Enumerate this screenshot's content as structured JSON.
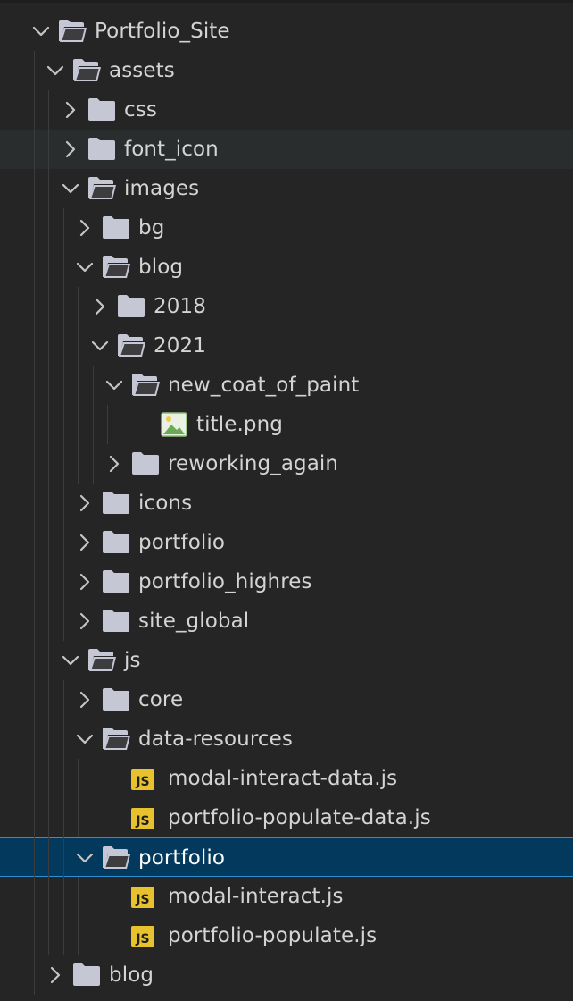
{
  "colors": {
    "background": "#252526",
    "text": "#d4d4d4",
    "selected_bg": "#04395e",
    "selected_border": "#2b8fd6",
    "hover_bg": "#2a2d2e",
    "folder_icon": "#c5c8d4",
    "js_badge": "#e8c12f"
  },
  "tree": [
    {
      "label": "Portfolio_Site",
      "depth": 0,
      "kind": "folder",
      "expanded": true,
      "icon": "folder-open-icon"
    },
    {
      "label": "assets",
      "depth": 1,
      "kind": "folder",
      "expanded": true,
      "icon": "folder-open-icon"
    },
    {
      "label": "css",
      "depth": 2,
      "kind": "folder",
      "expanded": false,
      "icon": "folder-icon"
    },
    {
      "label": "font_icon",
      "depth": 2,
      "kind": "folder",
      "expanded": false,
      "icon": "folder-icon",
      "hovered": true
    },
    {
      "label": "images",
      "depth": 2,
      "kind": "folder",
      "expanded": true,
      "icon": "folder-open-icon"
    },
    {
      "label": "bg",
      "depth": 3,
      "kind": "folder",
      "expanded": false,
      "icon": "folder-icon"
    },
    {
      "label": "blog",
      "depth": 3,
      "kind": "folder",
      "expanded": true,
      "icon": "folder-open-icon"
    },
    {
      "label": "2018",
      "depth": 4,
      "kind": "folder",
      "expanded": false,
      "icon": "folder-icon"
    },
    {
      "label": "2021",
      "depth": 4,
      "kind": "folder",
      "expanded": true,
      "icon": "folder-open-icon"
    },
    {
      "label": "new_coat_of_paint",
      "depth": 5,
      "kind": "folder",
      "expanded": true,
      "icon": "folder-open-icon"
    },
    {
      "label": "title.png",
      "depth": 6,
      "kind": "file",
      "icon": "image-file-icon"
    },
    {
      "label": "reworking_again",
      "depth": 5,
      "kind": "folder",
      "expanded": false,
      "icon": "folder-icon"
    },
    {
      "label": "icons",
      "depth": 3,
      "kind": "folder",
      "expanded": false,
      "icon": "folder-icon"
    },
    {
      "label": "portfolio",
      "depth": 3,
      "kind": "folder",
      "expanded": false,
      "icon": "folder-icon"
    },
    {
      "label": "portfolio_highres",
      "depth": 3,
      "kind": "folder",
      "expanded": false,
      "icon": "folder-icon"
    },
    {
      "label": "site_global",
      "depth": 3,
      "kind": "folder",
      "expanded": false,
      "icon": "folder-icon"
    },
    {
      "label": "js",
      "depth": 2,
      "kind": "folder",
      "expanded": true,
      "icon": "folder-open-icon"
    },
    {
      "label": "core",
      "depth": 3,
      "kind": "folder",
      "expanded": false,
      "icon": "folder-icon"
    },
    {
      "label": "data-resources",
      "depth": 3,
      "kind": "folder",
      "expanded": true,
      "icon": "folder-open-icon"
    },
    {
      "label": "modal-interact-data.js",
      "depth": 4,
      "kind": "file",
      "icon": "js-file-icon",
      "badge": "JS"
    },
    {
      "label": "portfolio-populate-data.js",
      "depth": 4,
      "kind": "file",
      "icon": "js-file-icon",
      "badge": "JS"
    },
    {
      "label": "portfolio",
      "depth": 3,
      "kind": "folder",
      "expanded": true,
      "icon": "folder-open-icon",
      "selected": true
    },
    {
      "label": "modal-interact.js",
      "depth": 4,
      "kind": "file",
      "icon": "js-file-icon",
      "badge": "JS"
    },
    {
      "label": "portfolio-populate.js",
      "depth": 4,
      "kind": "file",
      "icon": "js-file-icon",
      "badge": "JS"
    },
    {
      "label": "blog",
      "depth": 1,
      "kind": "folder",
      "expanded": false,
      "icon": "folder-icon"
    }
  ]
}
